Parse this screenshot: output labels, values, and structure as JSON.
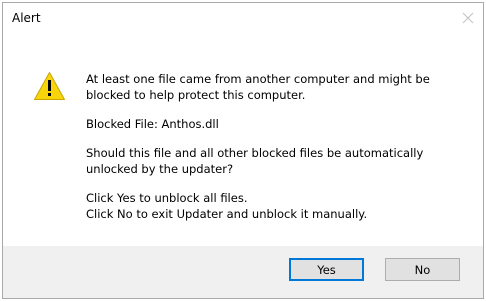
{
  "window": {
    "title": "Alert"
  },
  "message": {
    "icon": "warning-icon",
    "line1": "At least one file came from another computer and might be\nblocked to help protect this computer.",
    "line2": "Blocked File: Anthos.dll",
    "line3": "Should this file and all other blocked files be automatically\nunlocked by the updater?",
    "line4": "Click Yes to unblock all files.\nClick No to exit Updater and unblock it manually."
  },
  "buttons": {
    "yes_label": "Yes",
    "no_label": "No"
  },
  "colors": {
    "warning_yellow": "#f8d50a",
    "default_button_border": "#0078d7",
    "footer_background": "#f0f0f0"
  }
}
